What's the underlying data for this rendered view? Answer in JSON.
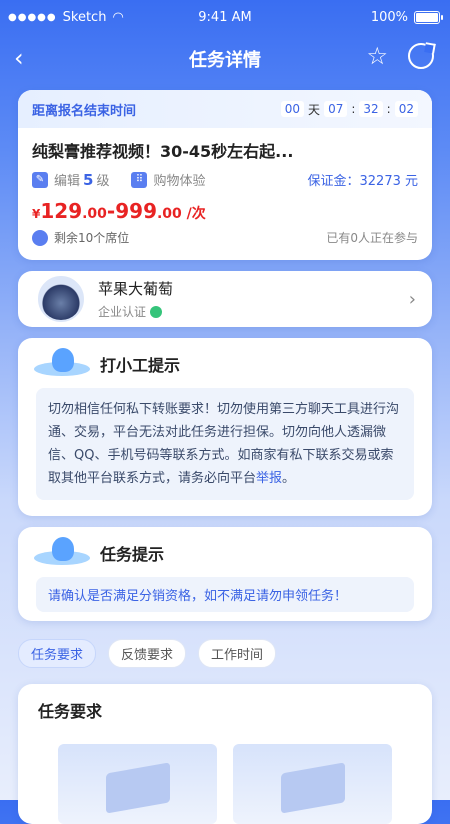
{
  "status_bar": {
    "carrier": "Sketch",
    "time": "9:41 AM",
    "battery": "100%",
    "battery_level": 1.0
  },
  "nav": {
    "title": "任务详情",
    "back_icon": "back-arrow-icon",
    "star_icon": "star-icon",
    "share_icon": "share-icon"
  },
  "task": {
    "deadline_label": "距离报名结束时间",
    "countdown": {
      "days": "00",
      "day_unit": "天",
      "hours": "07",
      "minutes": "32",
      "seconds": "02"
    },
    "title": "纯梨膏推荐视频！30-45秒左右起...",
    "type_label": "编辑",
    "level": "5",
    "level_unit": "级",
    "category": "购物体验",
    "deposit": "保证金：32273 元",
    "price_currency": "¥",
    "price_main1": "129",
    "price_dec1": ".00",
    "price_sep": "-",
    "price_main2": "999",
    "price_dec2": ".00",
    "price_unit": " /次",
    "seats_remaining": "剩余10个席位",
    "participants": "已有0人正在参与"
  },
  "merchant": {
    "name": "苹果大葡萄",
    "cert": "企业认证"
  },
  "tip": {
    "title": "打小工提示",
    "text": "切勿相信任何私下转账要求！切勿使用第三方聊天工具进行沟通、交易，平台无法对此任务进行担保。切勿向他人透漏微信、QQ、手机号码等联系方式。如商家有私下联系交易或索取其他平台联系方式，请务必向平台",
    "report_link": "举报",
    "text_end": "。"
  },
  "hint": {
    "title": "任务提示",
    "text": "请确认是否满足分销资格，如不满足请勿申领任务！"
  },
  "tabs": [
    {
      "label": "任务要求",
      "active": true
    },
    {
      "label": "反馈要求",
      "active": false
    },
    {
      "label": "工作时间",
      "active": false
    }
  ],
  "requirements": {
    "title": "任务要求"
  },
  "colors": {
    "primary": "#3b63e4",
    "price": "#e82323",
    "header_bg": "#3a6ef2"
  }
}
